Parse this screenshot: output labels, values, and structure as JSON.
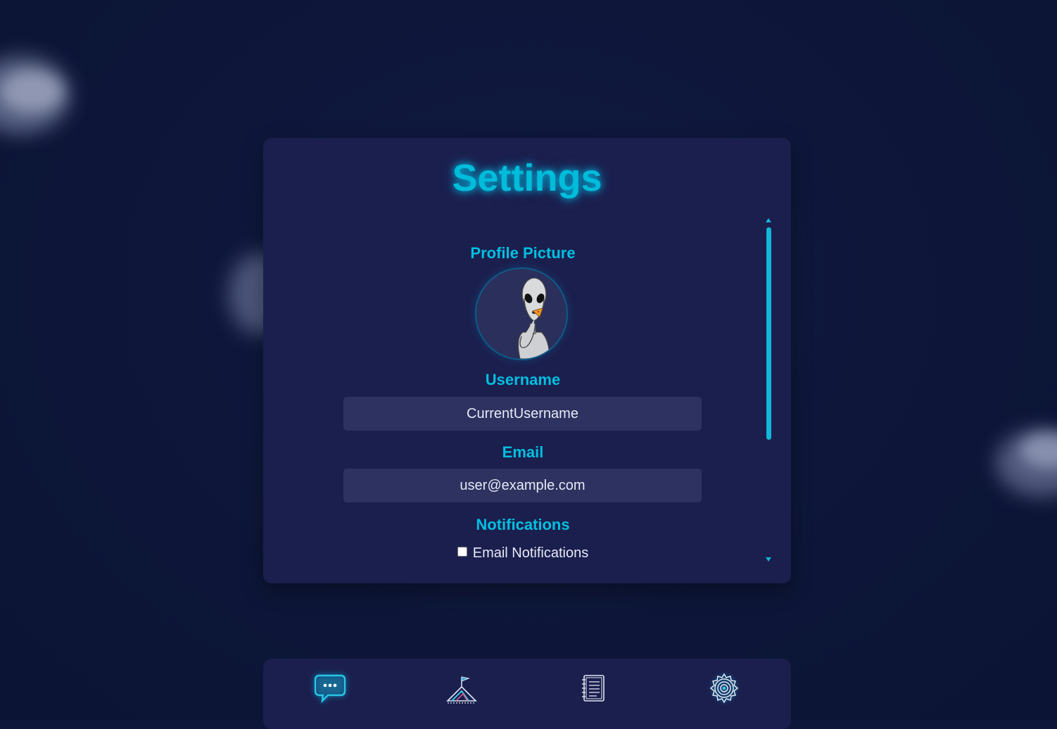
{
  "page": {
    "title": "Settings"
  },
  "profile": {
    "label": "Profile Picture",
    "avatar_icon": "alien-avatar"
  },
  "username": {
    "label": "Username",
    "value": "CurrentUsername"
  },
  "email": {
    "label": "Email",
    "value": "user@example.com"
  },
  "notifications": {
    "label": "Notifications",
    "email_notifications_label": "Email Notifications",
    "email_notifications_checked": false
  },
  "nav": {
    "items": [
      {
        "icon": "chat-bubble-icon"
      },
      {
        "icon": "mountain-flag-icon"
      },
      {
        "icon": "notebook-icon"
      },
      {
        "icon": "gear-icon"
      }
    ]
  },
  "colors": {
    "accent": "#00bcdb",
    "background": "#0e1739",
    "panel": "#1b1f4e",
    "input": "#2d3260"
  }
}
